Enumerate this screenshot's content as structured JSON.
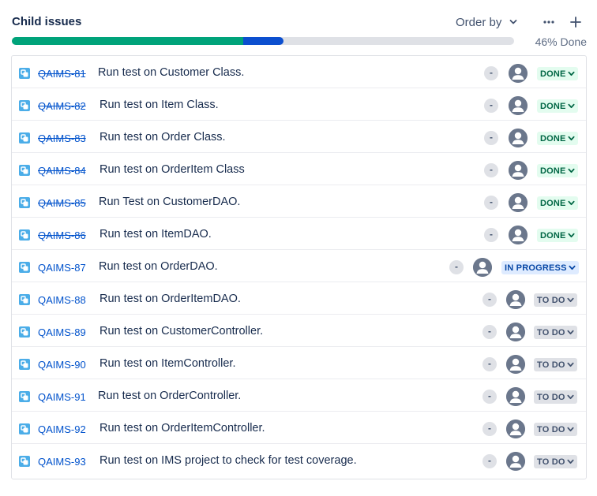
{
  "header": {
    "title": "Child issues",
    "order_by_label": "Order by"
  },
  "progress": {
    "done_fraction": 0.46,
    "in_progress_fraction": 0.08,
    "label": "46% Done",
    "done_color": "#00a37a",
    "in_progress_color": "#0c4fcf"
  },
  "issues": [
    {
      "key": "QAIMS-81",
      "summary": "Run test on Customer Class.",
      "priority": "-",
      "status": "DONE",
      "state": "done"
    },
    {
      "key": "QAIMS-82",
      "summary": "Run test on Item Class.",
      "priority": "-",
      "status": "DONE",
      "state": "done"
    },
    {
      "key": "QAIMS-83",
      "summary": "Run test on Order Class.",
      "priority": "-",
      "status": "DONE",
      "state": "done"
    },
    {
      "key": "QAIMS-84",
      "summary": "Run test on OrderItem Class",
      "priority": "-",
      "status": "DONE",
      "state": "done"
    },
    {
      "key": "QAIMS-85",
      "summary": "Run Test on CustomerDAO.",
      "priority": "-",
      "status": "DONE",
      "state": "done"
    },
    {
      "key": "QAIMS-86",
      "summary": "Run test on ItemDAO.",
      "priority": "-",
      "status": "DONE",
      "state": "done"
    },
    {
      "key": "QAIMS-87",
      "summary": "Run test on OrderDAO.",
      "priority": "-",
      "status": "IN PROGRESS",
      "state": "inprogress"
    },
    {
      "key": "QAIMS-88",
      "summary": "Run test on OrderItemDAO.",
      "priority": "-",
      "status": "TO DO",
      "state": "todo"
    },
    {
      "key": "QAIMS-89",
      "summary": "Run test on CustomerController.",
      "priority": "-",
      "status": "TO DO",
      "state": "todo"
    },
    {
      "key": "QAIMS-90",
      "summary": "Run test on ItemController.",
      "priority": "-",
      "status": "TO DO",
      "state": "todo"
    },
    {
      "key": "QAIMS-91",
      "summary": "Run test on OrderController.",
      "priority": "-",
      "status": "TO DO",
      "state": "todo"
    },
    {
      "key": "QAIMS-92",
      "summary": "Run test on OrderItemController.",
      "priority": "-",
      "status": "TO DO",
      "state": "todo"
    },
    {
      "key": "QAIMS-93",
      "summary": "Run test on IMS project to check for test coverage.",
      "priority": "-",
      "status": "TO DO",
      "state": "todo"
    }
  ],
  "icons": {
    "issue_type": "subtask-icon",
    "more": "more-icon",
    "add": "plus-icon",
    "order_chevron": "chevron-down-icon",
    "avatar": "unassigned-avatar-icon"
  },
  "colors": {
    "link": "#0052cc",
    "done_bg": "#e3fcef",
    "done_text": "#006644",
    "inprogress_bg": "#deebff",
    "inprogress_text": "#0747a6",
    "todo_bg": "#dfe1e6",
    "todo_text": "#42526e"
  }
}
